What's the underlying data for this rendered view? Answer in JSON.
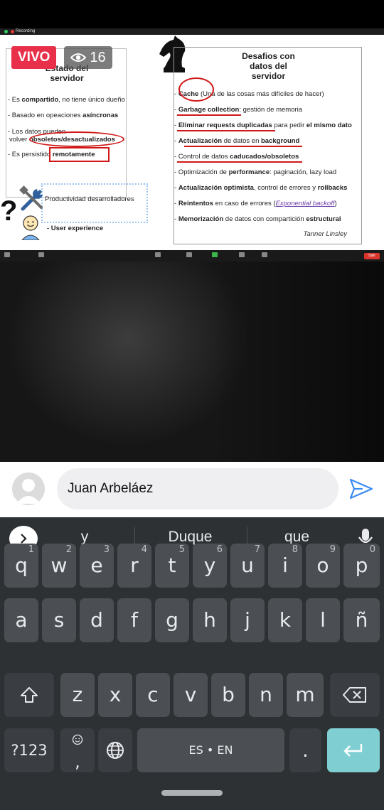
{
  "stream": {
    "live_label": "VIVO",
    "viewer_count": "16",
    "recording_label": "Recording"
  },
  "slide": {
    "left_card": {
      "title_line1": "Estado del",
      "title_line2": "servidor",
      "bullets": [
        {
          "prefix": "- Es ",
          "bold": "compartido",
          "suffix": ", no tiene único dueño"
        },
        {
          "prefix": "- Basado en opeaciones ",
          "bold": "asíncronas",
          "suffix": ""
        },
        {
          "prefix": "- Los datos pueden",
          "bold": "",
          "suffix": ""
        },
        {
          "prefix": "volver ",
          "bold": "obsoletos/desactualizados",
          "suffix": ""
        },
        {
          "prefix": "- Es persistido ",
          "bold": "remotamente",
          "suffix": ""
        }
      ],
      "productivity_label": "Productividad desarrolladores",
      "ux_label": "- User experience",
      "question_mark": "?"
    },
    "right_card": {
      "title_line1": "Desafios con",
      "title_line2": "datos del",
      "title_line3": "servidor",
      "bullets": [
        {
          "prefix": "- ",
          "bold": "Cache",
          "suffix": " (Una de las cosas más difíciles de hacer)"
        },
        {
          "prefix": "- ",
          "bold": "Garbage collection",
          "suffix": ": gestión de memoria"
        },
        {
          "prefix": "- ",
          "bold": "Eliminar requests duplicadas",
          "suffix": " para pedir ",
          "bold2": "el mismo dato"
        },
        {
          "prefix": "- ",
          "bold": "Actualización",
          "suffix": " de datos en ",
          "bold2": "background"
        },
        {
          "prefix": "- Control de datos ",
          "bold": "caducados/obsoletos",
          "suffix": ""
        },
        {
          "prefix": "- Optimización de ",
          "bold": "performance",
          "suffix": ": paginación, lazy load"
        },
        {
          "prefix": "- ",
          "bold": "Actualización optimista",
          "suffix": ", control de errores y ",
          "bold2": "rollbacks"
        },
        {
          "prefix": "- ",
          "bold": "Reintentos",
          "suffix": " en caso de errores (",
          "link": "Exponential backoff",
          "suffix2": ")"
        },
        {
          "prefix": "- ",
          "bold": "Memorización",
          "suffix": " de datos con compartición ",
          "bold2": "estructural"
        }
      ],
      "author": "Tanner Linsley"
    }
  },
  "meeting_toolbar": {
    "chat_badge": "15",
    "leave_label": "Salir"
  },
  "comment": {
    "input_value": "Juan Arbeláez",
    "send_icon": "send-icon"
  },
  "keyboard": {
    "suggestions": [
      "y",
      "Duque",
      "que"
    ],
    "row1": [
      {
        "key": "q",
        "num": "1"
      },
      {
        "key": "w",
        "num": "2"
      },
      {
        "key": "e",
        "num": "3"
      },
      {
        "key": "r",
        "num": "4"
      },
      {
        "key": "t",
        "num": "5"
      },
      {
        "key": "y",
        "num": "6"
      },
      {
        "key": "u",
        "num": "7"
      },
      {
        "key": "i",
        "num": "8"
      },
      {
        "key": "o",
        "num": "9"
      },
      {
        "key": "p",
        "num": "0"
      }
    ],
    "row2": [
      "a",
      "s",
      "d",
      "f",
      "g",
      "h",
      "j",
      "k",
      "l",
      "ñ"
    ],
    "row3": [
      "z",
      "x",
      "c",
      "v",
      "b",
      "n",
      "m"
    ],
    "symbols_label": "?123",
    "comma_label": ",",
    "space_label": "ES • EN",
    "period_label": "."
  }
}
